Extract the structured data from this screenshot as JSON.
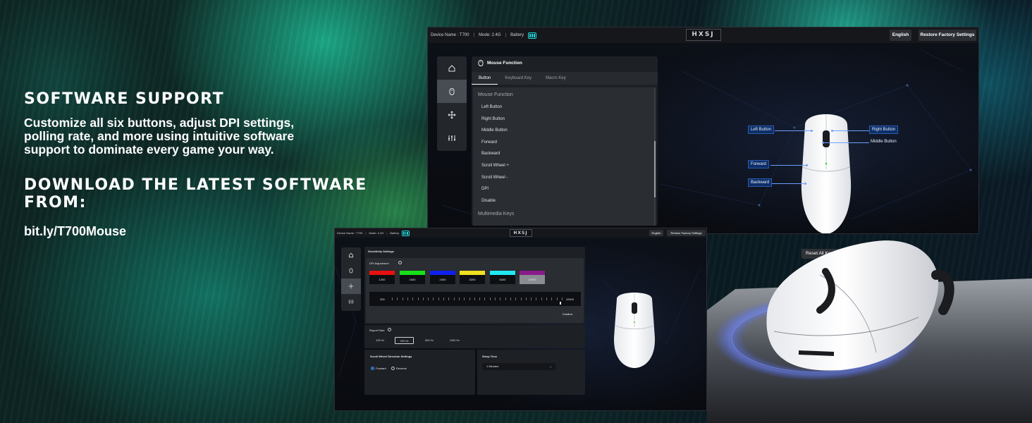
{
  "promo": {
    "heading": "SOFTWARE SUPPORT",
    "body": "Customize all six buttons, adjust DPI settings, polling rate, and more using intuitive software support to dominate every game your way.",
    "download_heading": "DOWNLOAD THE LATEST SOFTWARE FROM:",
    "link": "bit.ly/T700Mouse"
  },
  "topbar": {
    "device": "Device Name : T700",
    "mode": "Mode: 2.4G",
    "battery": "Battery",
    "separator": "|",
    "logo": "HXSJ",
    "language": "English",
    "restore": "Restore Factory Settings"
  },
  "sidebar_icons": [
    "home-icon",
    "mouse-icon",
    "move-icon",
    "sliders-icon"
  ],
  "mouse_function": {
    "title": "Mouse Function",
    "tabs": [
      "Button",
      "Keyboard Key",
      "Macro Key"
    ],
    "group1": "Mouse Function",
    "items": [
      "Left Button",
      "Right Button",
      "Middle Button",
      "Forward",
      "Backward",
      "Scroll Wheel +",
      "Scroll Wheel -",
      "DPI",
      "Disable"
    ],
    "group2": "Multimedia Keys"
  },
  "diagram": {
    "left": "Left Button",
    "right": "Right Button",
    "middle": "Middle Button",
    "forward": "Forward",
    "backward": "Backward",
    "reset": "Reset All Keys"
  },
  "sensitivity": {
    "title": "Sensitivity Settings",
    "dpi_label": "DPI Adjustment",
    "dpi_levels": [
      {
        "value": "1200",
        "color": "#e81010"
      },
      {
        "value": "1600",
        "color": "#18e018"
      },
      {
        "value": "2400",
        "color": "#1020ee"
      },
      {
        "value": "3200",
        "color": "#f0e020"
      },
      {
        "value": "6400",
        "color": "#20e8f0"
      },
      {
        "value": "10000",
        "color": "#8a1a8a"
      }
    ],
    "slider_min": "200",
    "slider_max": "10000",
    "confirm": "Confirm",
    "report_label": "Report Rate",
    "rates": [
      "125 Hz",
      "250 Hz",
      "500 Hz",
      "1000 Hz"
    ],
    "selected_rate_index": 1,
    "scroll_title": "Scroll Wheel Direction Settings",
    "forward": "Forward",
    "reverse": "Reverse",
    "sleep_title": "Sleep Time",
    "sleep_value": "1 Minutes"
  }
}
